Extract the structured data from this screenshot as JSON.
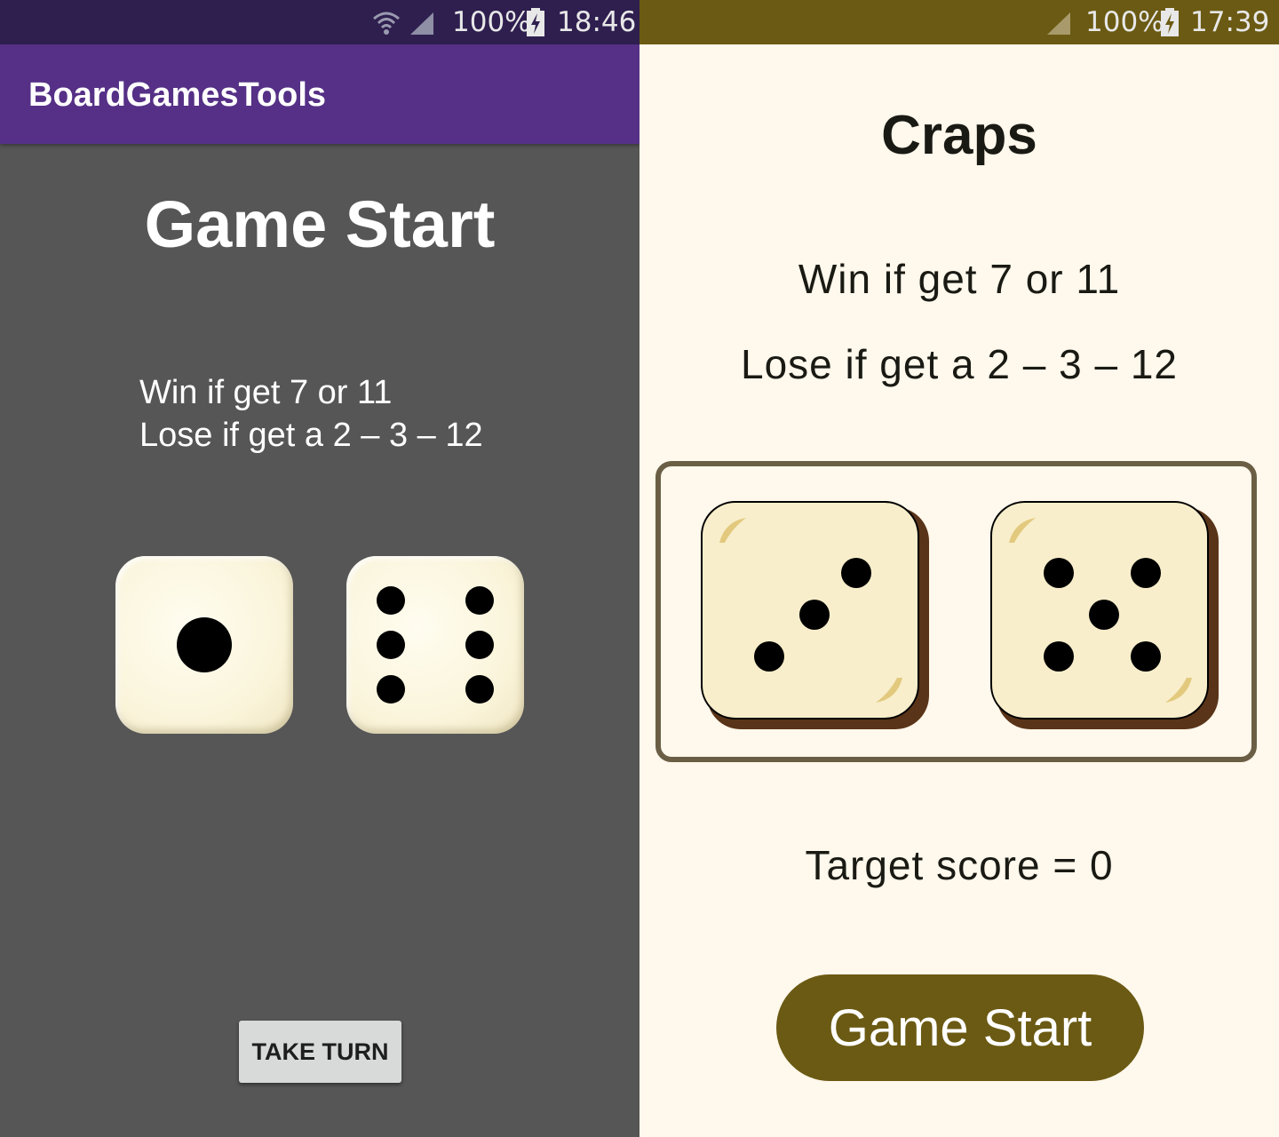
{
  "left_screen": {
    "status_bar": {
      "battery": "100%",
      "time": "18:46",
      "icons": [
        "wifi-icon",
        "signal-icon",
        "battery-charging-icon"
      ]
    },
    "app_bar": {
      "title": "BoardGamesTools"
    },
    "heading": "Game Start",
    "rules": [
      "Win if get 7 or 11",
      "Lose if get a 2 – 3 – 12"
    ],
    "dice": [
      1,
      6
    ],
    "take_turn_label": "TAKE TURN",
    "colors": {
      "background": "#565656",
      "app_bar": "#553086",
      "status_bar": "#2F1F4F"
    }
  },
  "right_screen": {
    "status_bar": {
      "battery": "100%",
      "time": "17:39",
      "icons": [
        "signal-icon",
        "battery-charging-icon"
      ]
    },
    "heading": "Craps",
    "rules": [
      "Win if get 7 or 11",
      "Lose if get a 2 – 3 – 12"
    ],
    "dice": [
      3,
      5
    ],
    "target_score": "Target score = 0",
    "start_button_label": "Game Start",
    "colors": {
      "background": "#FFF8EC",
      "accent": "#6B5A13",
      "die_face": "#F8EECB",
      "die_edge": "#5A3418"
    }
  }
}
